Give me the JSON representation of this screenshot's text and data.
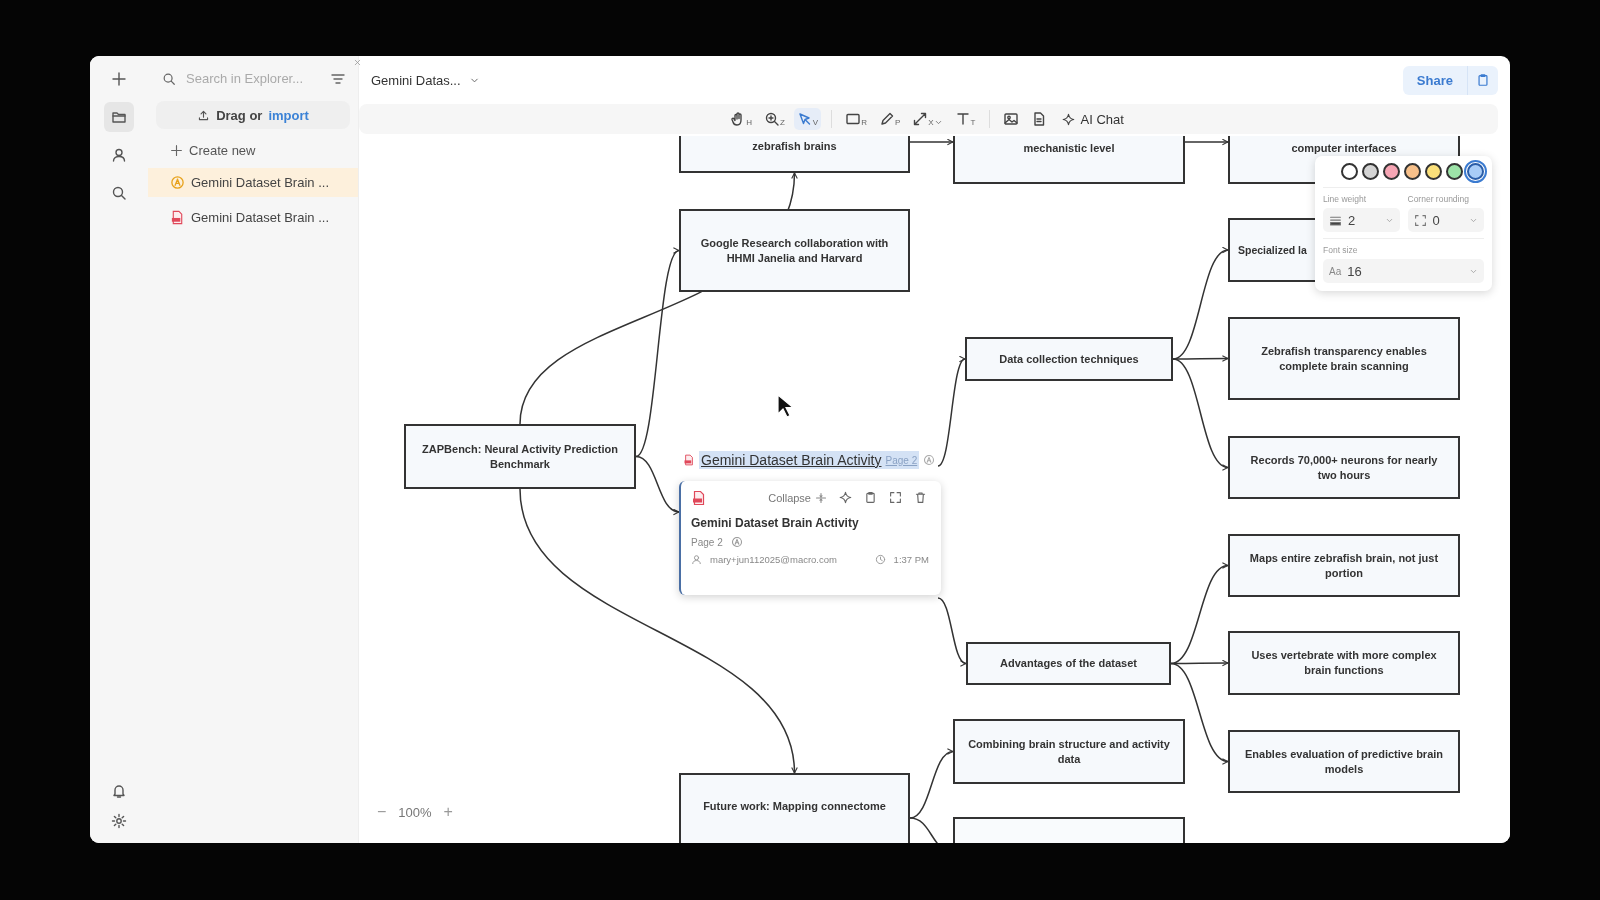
{
  "rail": {
    "top": [
      {
        "kind": "plus",
        "selected": false
      },
      {
        "kind": "folder",
        "selected": true
      },
      {
        "kind": "person",
        "selected": false
      },
      {
        "kind": "search",
        "selected": false
      }
    ],
    "bottom": [
      {
        "kind": "bell"
      },
      {
        "kind": "gear"
      }
    ]
  },
  "explorer": {
    "search": {
      "placeholder": "Search in Explorer..."
    },
    "import": {
      "text": "Drag or",
      "link": "import"
    },
    "create": "Create new",
    "items": [
      {
        "kind": "chat",
        "label": "Gemini Dataset Brain ...",
        "selected": true
      },
      {
        "kind": "pdf",
        "label": "Gemini Dataset Brain ...",
        "selected": false
      }
    ]
  },
  "header": {
    "title": "Gemini Datas...",
    "share": "Share"
  },
  "toolbar": {
    "tools": [
      {
        "kind": "hand",
        "shortcut": "H",
        "selected": false
      },
      {
        "kind": "zoom",
        "shortcut": "Z",
        "selected": false
      },
      {
        "kind": "select",
        "shortcut": "V",
        "selected": true
      },
      {
        "kind": "rect",
        "shortcut": "R",
        "selected": false
      },
      {
        "kind": "pencil",
        "shortcut": "P",
        "selected": false
      },
      {
        "kind": "line",
        "shortcut": "X",
        "selected": false
      },
      {
        "kind": "text",
        "shortcut": "T",
        "selected": false
      },
      {
        "kind": "image",
        "selected": false
      },
      {
        "kind": "doc",
        "selected": false
      }
    ],
    "ai_chat": "AI Chat"
  },
  "canvas": {
    "nodes": [
      {
        "kind": "box",
        "text": "zebrafish brains"
      },
      {
        "kind": "box",
        "text": "mechanistic level"
      },
      {
        "kind": "box",
        "text": "computer interfaces"
      },
      {
        "kind": "box",
        "text": "Google Research collaboration with HHMI Janelia and Harvard"
      },
      {
        "kind": "box",
        "text": "Specialized la"
      },
      {
        "kind": "box",
        "text": "Data collection techniques"
      },
      {
        "kind": "box",
        "text": "Zebrafish transparency enables complete brain scanning"
      },
      {
        "kind": "box",
        "text": "ZAPBench: Neural Activity Prediction Benchmark"
      },
      {
        "kind": "box",
        "text": "Records 70,000+ neurons for nearly two hours"
      },
      {
        "kind": "box",
        "text": "Maps entire zebrafish brain, not just portion"
      },
      {
        "kind": "box",
        "text": "Advantages of the dataset"
      },
      {
        "kind": "box",
        "text": "Uses vertebrate with more complex brain functions"
      },
      {
        "kind": "box",
        "text": "Combining brain structure and activity data"
      },
      {
        "kind": "box",
        "text": "Enables evaluation of predictive brain models"
      },
      {
        "kind": "box",
        "text": "Future work: Mapping connectome"
      },
      {
        "kind": "blank"
      }
    ],
    "reference": {
      "title": "Gemini Dataset Brain Activity",
      "page": "Page 2",
      "highlighted": true
    },
    "card": {
      "collapse": "Collapse",
      "title": "Gemini Dataset Brain Activity",
      "page": "Page 2",
      "email": "mary+jun112025@macro.com",
      "time": "1:37 PM"
    },
    "zoom": {
      "minus": "−",
      "level": "100%",
      "plus": "+"
    }
  },
  "style_panel": {
    "swatches": [
      {
        "color": "#ffffff",
        "selected": false
      },
      {
        "color": "#d4d4d4",
        "selected": false
      },
      {
        "color": "#f6a5b4",
        "selected": false
      },
      {
        "color": "#f7c08a",
        "selected": false
      },
      {
        "color": "#fbe07a",
        "selected": false
      },
      {
        "color": "#9de3a8",
        "selected": false
      },
      {
        "color": "#a9cdf7",
        "selected": true
      }
    ],
    "line_weight": {
      "label": "Line weight",
      "value": "2"
    },
    "corner_rounding": {
      "label": "Corner rounding",
      "value": "0"
    },
    "font_size": {
      "label": "Font size",
      "prefix": "Aa",
      "value": "16"
    }
  }
}
